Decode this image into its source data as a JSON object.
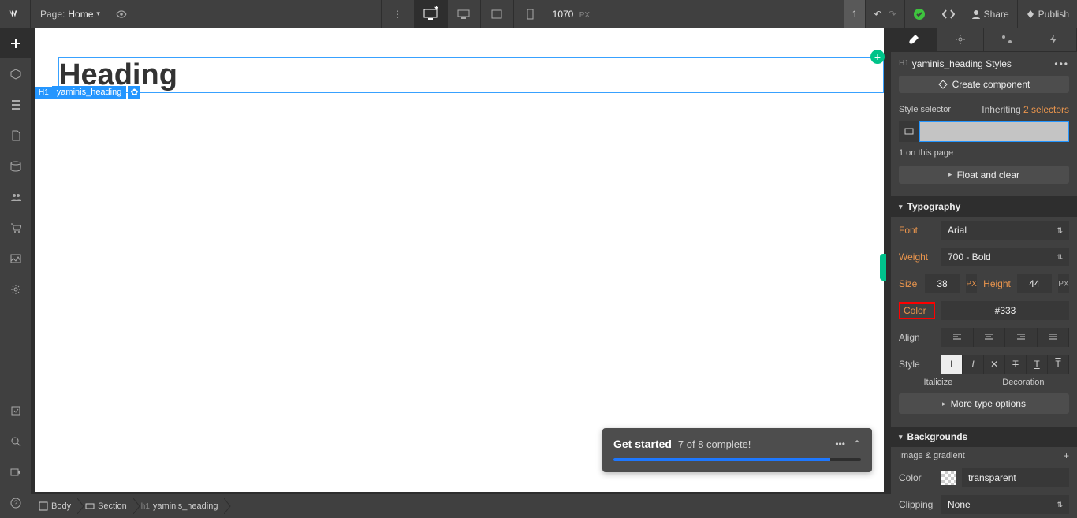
{
  "topbar": {
    "page_label": "Page:",
    "page_name": "Home",
    "canvas_width": "1070",
    "canvas_unit": "PX",
    "badge1": "1",
    "share": "Share",
    "publish": "Publish"
  },
  "canvas": {
    "heading_text": "Heading",
    "sel_h1": "H1",
    "sel_class": "yaminis_heading"
  },
  "breadcrumbs": [
    {
      "icon": "body",
      "label": "Body"
    },
    {
      "icon": "section",
      "label": "Section"
    },
    {
      "icon": "h1",
      "label": "yaminis_heading"
    }
  ],
  "toast": {
    "title": "Get started",
    "subtitle": "7 of 8 complete!",
    "progress_pct": 87.5
  },
  "right": {
    "header_tag": "H1",
    "header_title": "yaminis_heading Styles",
    "create_component": "Create component",
    "style_selector_label": "Style selector",
    "inheriting_label": "Inheriting",
    "inheriting_count": "2 selectors",
    "on_page": "1 on this page",
    "float_clear": "Float and clear",
    "typography": {
      "title": "Typography",
      "font_label": "Font",
      "font_value": "Arial",
      "weight_label": "Weight",
      "weight_value": "700 - Bold",
      "size_label": "Size",
      "size_value": "38",
      "size_unit": "PX",
      "height_label": "Height",
      "height_value": "44",
      "height_unit": "PX",
      "color_label": "Color",
      "color_value": "#333",
      "align_label": "Align",
      "style_label": "Style",
      "sub_italicize": "Italicize",
      "sub_decoration": "Decoration",
      "more": "More type options"
    },
    "backgrounds": {
      "title": "Backgrounds",
      "image_gradient": "Image & gradient",
      "color_label": "Color",
      "color_value": "transparent",
      "clipping_label": "Clipping",
      "clipping_value": "None"
    }
  }
}
